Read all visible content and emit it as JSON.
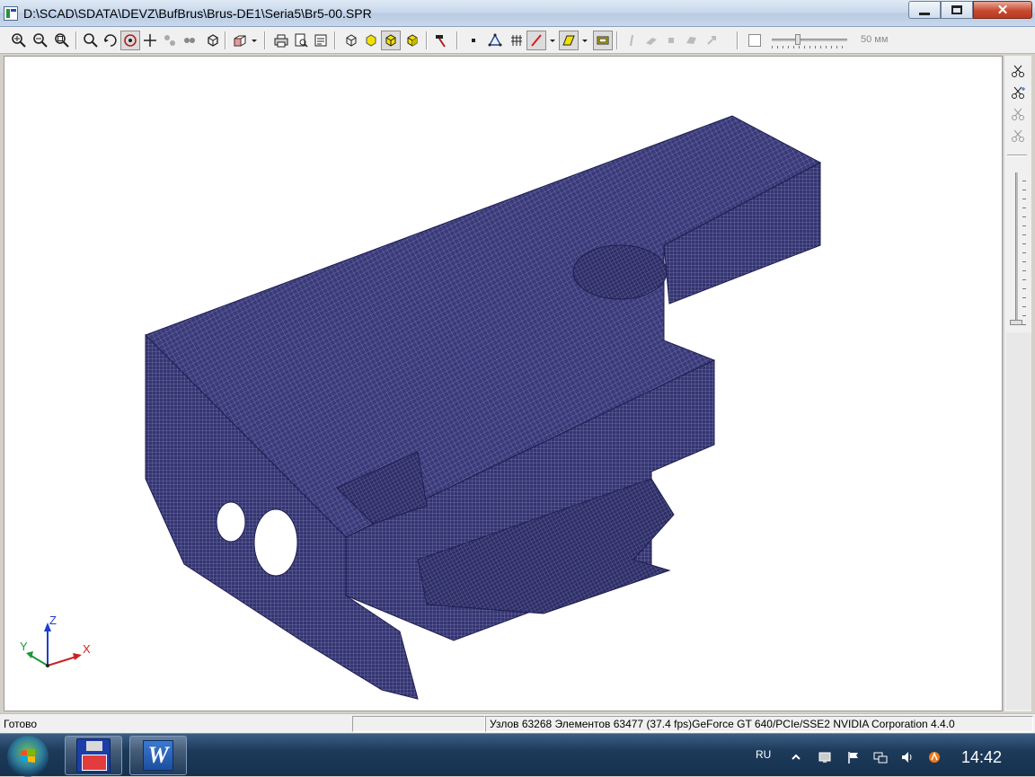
{
  "window": {
    "title": "D:\\SCAD\\SDATA\\DEVZ\\BufBrus\\Brus-DE1\\Seria5\\Br5-00.SPR"
  },
  "toolbar": {
    "slider_value_label": "50 мм",
    "buttons": [
      "zoom-in-icon",
      "zoom-out-icon",
      "zoom-extents-icon",
      "zoom-window-icon",
      "rotate-icon",
      "pan-icon",
      "move-icon",
      "copy-icon",
      "cube-icon",
      "box-dropdown-icon",
      "print-icon",
      "print-preview-icon",
      "export-icon",
      "wireframe-icon",
      "solid-yellow-icon",
      "solid-box-icon",
      "solid-cube-icon",
      "hammer-icon",
      "node-icon",
      "element-triangle-icon",
      "grid-icon",
      "line-color-icon",
      "fill-color-icon",
      "frame-icon"
    ]
  },
  "viewport": {
    "mesh_color": "#3a3a7a",
    "mesh_line_color": "#c8c8e8",
    "background": "#ffffff",
    "axes": {
      "x_label": "X",
      "y_label": "Y",
      "z_label": "Z",
      "x_color": "#cc2222",
      "y_color": "#1a9a3a",
      "z_color": "#1a3fd0"
    }
  },
  "right_toolbar": {
    "buttons": [
      "scissors-icon",
      "scissors-plus-icon",
      "scissors-gear-icon",
      "scissors-cross-icon"
    ]
  },
  "status": {
    "ready": "Готово",
    "info": "Узлов 63268  Элементов 63477  (37.4 fps)GeForce GT 640/PCIe/SSE2 NVIDIA Corporation 4.4.0"
  },
  "taskbar": {
    "items": [
      "floppy-app-icon",
      "word-icon"
    ],
    "language": "RU",
    "clock": "14:42",
    "tray": [
      "show-desktop-icon",
      "flag-icon",
      "network-icon",
      "volume-icon",
      "avast-icon"
    ]
  }
}
